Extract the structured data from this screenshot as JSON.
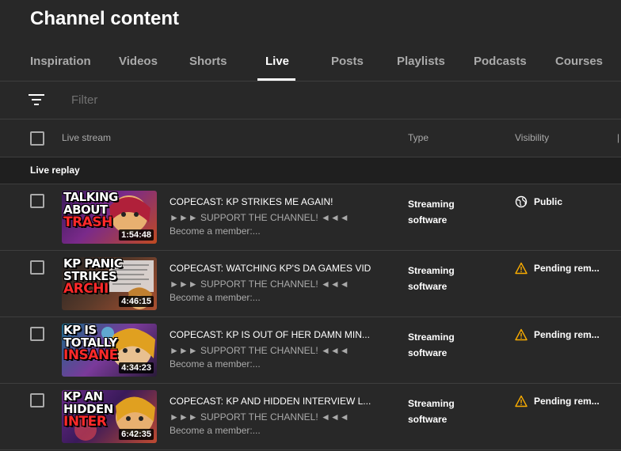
{
  "page": {
    "title": "Channel content"
  },
  "tabs": [
    {
      "label": "Inspiration",
      "active": false
    },
    {
      "label": "Videos",
      "active": false
    },
    {
      "label": "Shorts",
      "active": false
    },
    {
      "label": "Live",
      "active": true
    },
    {
      "label": "Posts",
      "active": false
    },
    {
      "label": "Playlists",
      "active": false
    },
    {
      "label": "Podcasts",
      "active": false
    },
    {
      "label": "Courses",
      "active": false
    }
  ],
  "filter": {
    "icon": "filter-icon",
    "placeholder": "Filter"
  },
  "table": {
    "columns": {
      "stream": "Live stream",
      "type": "Type",
      "visibility": "Visibility"
    },
    "section_label": "Live replay",
    "rows": [
      {
        "title": "COPECAST: KP STRIKES ME AGAIN!",
        "desc1": "►►► SUPPORT THE CHANNEL! ◄◄◄",
        "desc2": "Become a member:...",
        "duration": "1:54:48",
        "thumb_lines": [
          "TALKING",
          "ABOUT"
        ],
        "thumb_red": "TRASH",
        "type": "Streaming software",
        "visibility": "Public",
        "visibility_icon": "globe-icon"
      },
      {
        "title": "COPECAST: WATCHING KP'S DA GAMES VID",
        "desc1": "►►► SUPPORT THE CHANNEL! ◄◄◄",
        "desc2": "Become a member:...",
        "duration": "4:46:15",
        "thumb_lines": [
          "KP PANIC",
          "STRIKES"
        ],
        "thumb_red": "ARCHI",
        "type": "Streaming software",
        "visibility": "Pending rem...",
        "visibility_icon": "warning-icon"
      },
      {
        "title": "COPECAST: KP IS OUT OF HER DAMN MIN...",
        "desc1": "►►► SUPPORT THE CHANNEL! ◄◄◄",
        "desc2": "Become a member:...",
        "duration": "4:34:23",
        "thumb_lines": [
          "KP IS",
          "TOTALLY"
        ],
        "thumb_red": "INSANE",
        "type": "Streaming software",
        "visibility": "Pending rem...",
        "visibility_icon": "warning-icon"
      },
      {
        "title": "COPECAST: KP AND HIDDEN INTERVIEW L...",
        "desc1": "►►► SUPPORT THE CHANNEL! ◄◄◄",
        "desc2": "Become a member:...",
        "duration": "6:42:35",
        "thumb_lines": [
          "KP AN",
          "HIDDEN"
        ],
        "thumb_red": "INTER",
        "type": "Streaming software",
        "visibility": "Pending rem...",
        "visibility_icon": "warning-icon"
      }
    ]
  },
  "colors": {
    "background": "#282828",
    "section_bg": "#1f1f1f",
    "warning": "#f9ab00",
    "muted": "#aaaaaa"
  }
}
